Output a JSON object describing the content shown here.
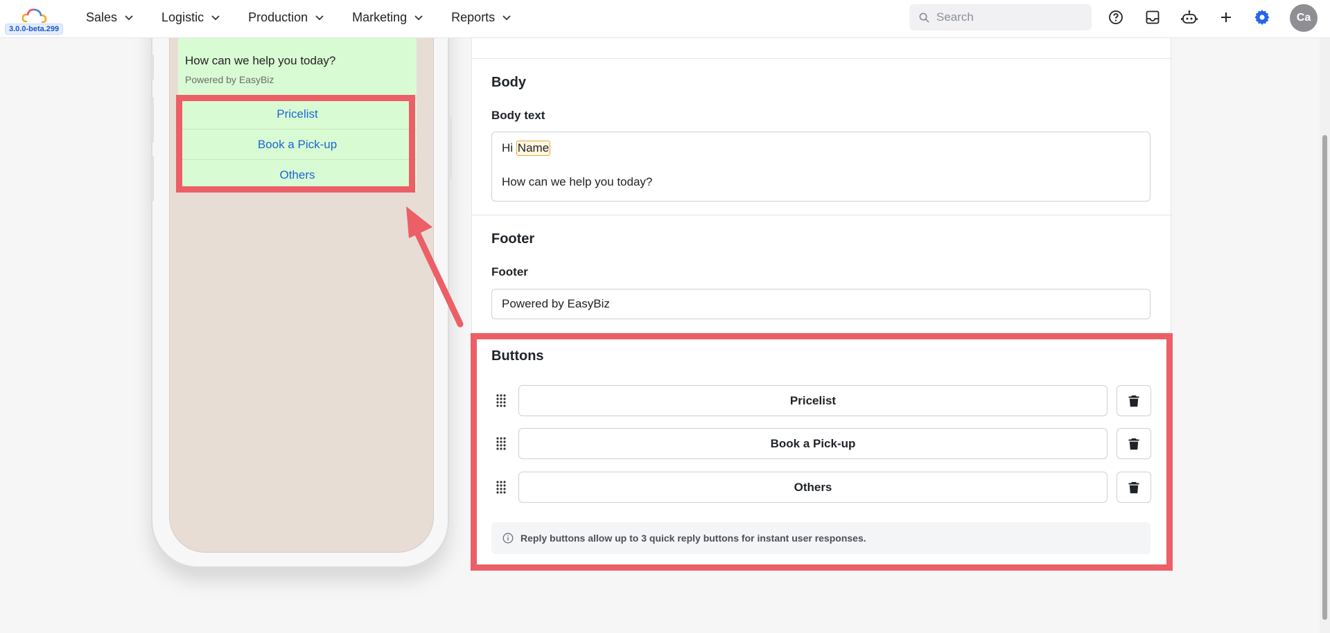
{
  "app": {
    "version": "3.0.0-beta.299"
  },
  "nav": {
    "menu": [
      {
        "label": "Sales"
      },
      {
        "label": "Logistic"
      },
      {
        "label": "Production"
      },
      {
        "label": "Marketing"
      },
      {
        "label": "Reports"
      }
    ],
    "search_placeholder": "Search",
    "avatar_initials": "Ca",
    "icons": [
      "help-icon",
      "inbox-icon",
      "bot-icon",
      "plus-icon",
      "settings-icon"
    ],
    "accent_color": "#2563eb"
  },
  "preview": {
    "message_text": "How can we help you today?",
    "footer_text": "Powered by EasyBiz",
    "quick_replies": [
      {
        "label": "Pricelist"
      },
      {
        "label": "Book a Pick-up"
      },
      {
        "label": "Others"
      }
    ]
  },
  "body_section": {
    "title": "Body",
    "field_label": "Body text",
    "greeting": "Hi",
    "variable": "Name",
    "line2": "How can we help you today?"
  },
  "footer_section": {
    "title": "Footer",
    "field_label": "Footer",
    "value": "Powered by EasyBiz"
  },
  "buttons_section": {
    "title": "Buttons",
    "buttons": [
      {
        "label": "Pricelist"
      },
      {
        "label": "Book a Pick-up"
      },
      {
        "label": "Others"
      }
    ],
    "info": "Reply buttons allow up to 3 quick reply buttons for instant user responses."
  },
  "annotation_color": "#ec5f66"
}
